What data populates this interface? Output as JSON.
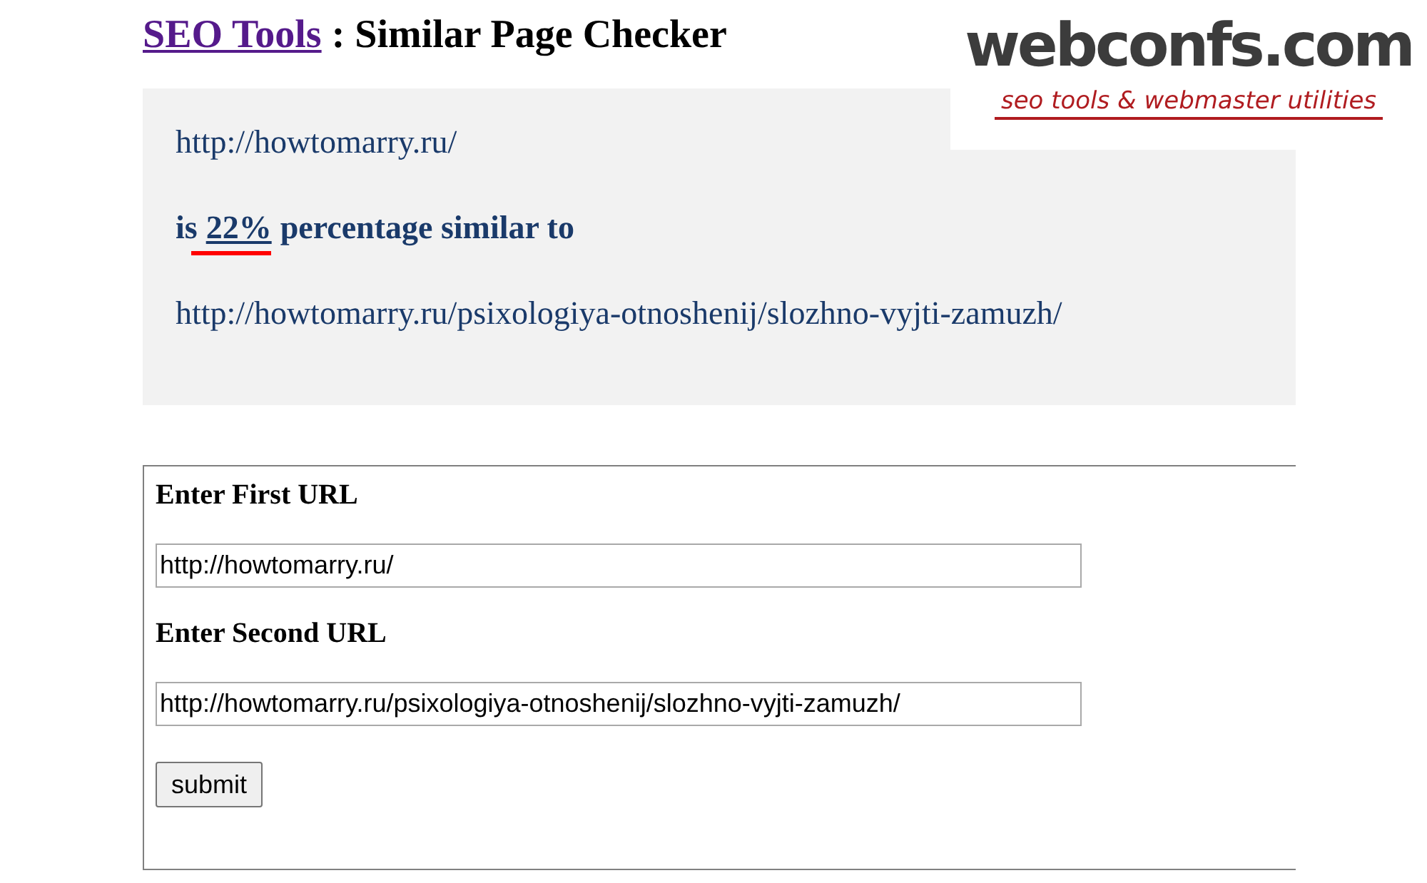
{
  "header": {
    "link": "SEO Tools",
    "title": " : Similar Page Checker"
  },
  "logo": {
    "name": "webconfs.com",
    "tagline": "seo tools & webmaster utilities"
  },
  "result": {
    "first_url": "http://howtomarry.ru/",
    "prefix": "is",
    "percent": "22%",
    "suffix": "percentage similar to",
    "second_url": "http://howtomarry.ru/psixologiya-otnoshenij/slozhno-vyjti-zamuzh/"
  },
  "form": {
    "first_label": "Enter First URL",
    "first_value": "http://howtomarry.ru/",
    "second_label": "Enter Second URL",
    "second_value": "http://howtomarry.ru/psixologiya-otnoshenij/slozhno-vyjti-zamuzh/",
    "submit": "submit"
  }
}
